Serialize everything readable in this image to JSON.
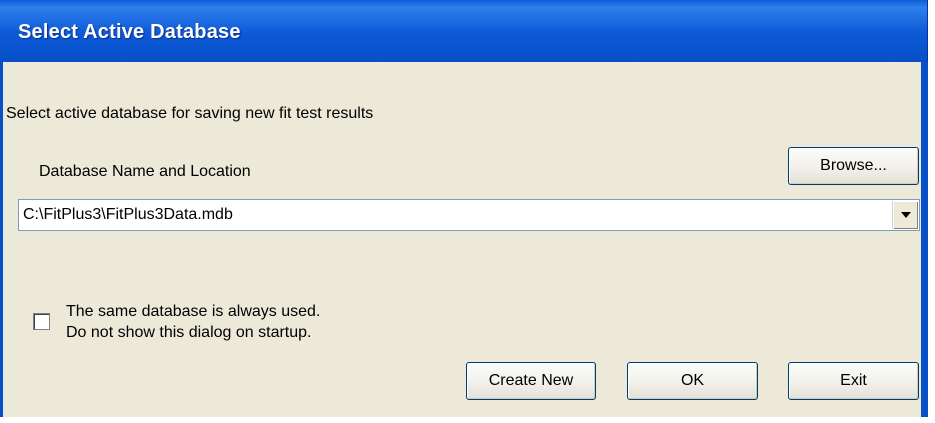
{
  "window": {
    "title": "Select Active Database"
  },
  "dialog": {
    "instruction": "Select active database for saving new fit test results",
    "db_label": "Database Name and Location",
    "browse_label": "Browse...",
    "db_path": "C:\\FitPlus3\\FitPlus3Data.mdb",
    "checkbox_line1": "The same database is always used.",
    "checkbox_line2": "Do not show this dialog on startup.",
    "checkbox_checked": false,
    "create_new_label": "Create New",
    "ok_label": "OK",
    "exit_label": "Exit"
  },
  "colors": {
    "titlebar": "#0850c8",
    "face": "#ece9d8",
    "button_border": "#003c74"
  }
}
